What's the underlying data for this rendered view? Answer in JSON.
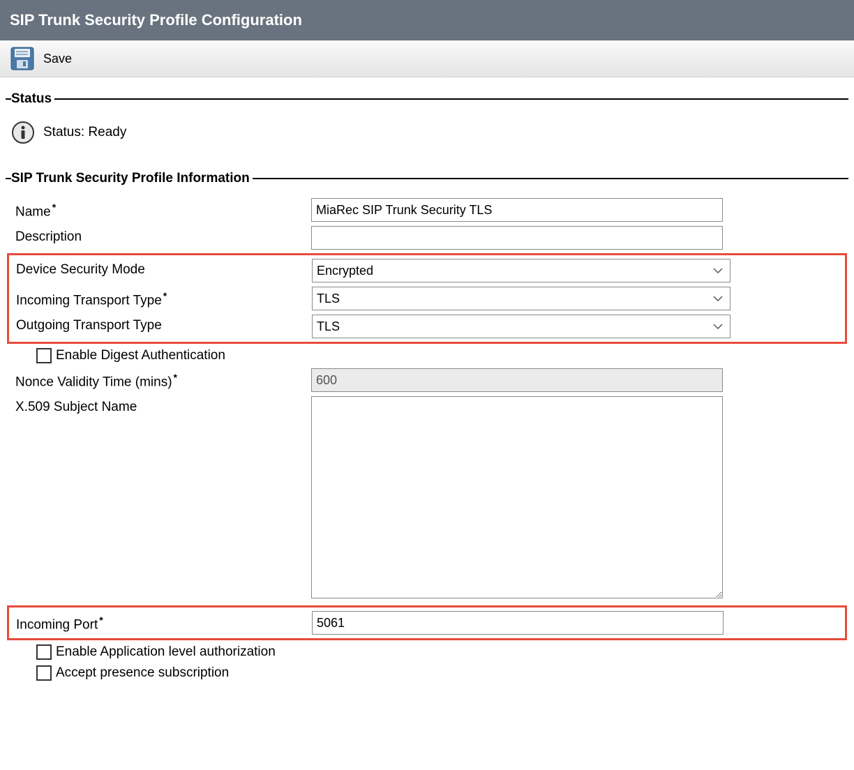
{
  "header": {
    "title": "SIP Trunk Security Profile Configuration"
  },
  "toolbar": {
    "save_label": "Save"
  },
  "status": {
    "legend": "Status",
    "text": "Status: Ready"
  },
  "profile": {
    "legend": "SIP Trunk Security Profile Information",
    "name_label": "Name",
    "name_value": "MiaRec SIP Trunk Security TLS",
    "description_label": "Description",
    "description_value": "",
    "device_security_mode_label": "Device Security Mode",
    "device_security_mode_value": "Encrypted",
    "incoming_transport_label": "Incoming Transport Type",
    "incoming_transport_value": "TLS",
    "outgoing_transport_label": "Outgoing Transport Type",
    "outgoing_transport_value": "TLS",
    "enable_digest_label": "Enable Digest Authentication",
    "nonce_validity_label": "Nonce Validity Time (mins)",
    "nonce_validity_value": "600",
    "x509_label": "X.509 Subject Name",
    "x509_value": "",
    "incoming_port_label": "Incoming Port",
    "incoming_port_value": "5061",
    "enable_app_auth_label": "Enable Application level authorization",
    "accept_presence_label": "Accept presence subscription"
  }
}
